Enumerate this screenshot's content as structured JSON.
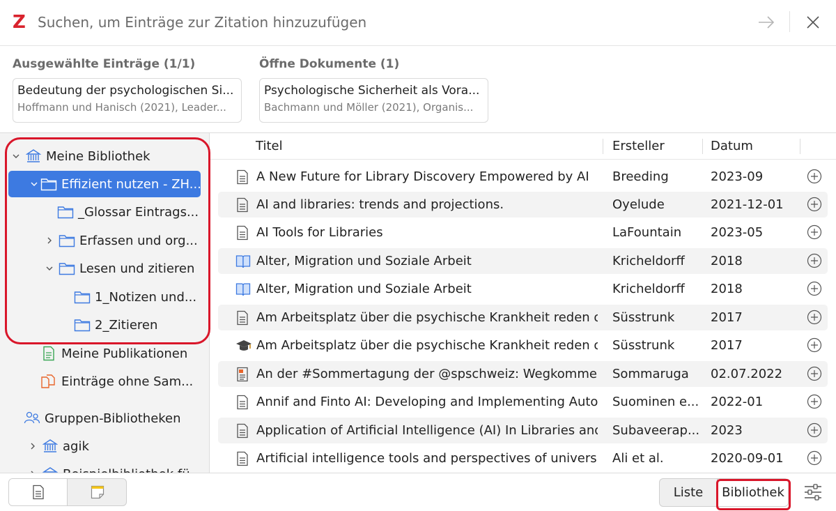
{
  "search": {
    "logo": "Z",
    "placeholder": "Suchen, um Einträge zur Zitation hinzuzufügen"
  },
  "bubbles": {
    "selected_title": "Ausgewählte Einträge (1/1)",
    "open_title": "Öffne Dokumente (1)",
    "selected_item": {
      "title": "Bedeutung der psychologischen Si...",
      "subtitle": "Hoffmann und Hanisch (2021), Leader..."
    },
    "open_item": {
      "title": "Psychologische Sicherheit als Vora...",
      "subtitle": "Bachmann und Möller (2021), Organis..."
    }
  },
  "tree": {
    "items": [
      {
        "label": "Meine Bibliothek",
        "icon": "library-icon",
        "twisty": "chevron-down"
      },
      {
        "label": "Effizient nutzen - ZH...",
        "icon": "folder-icon",
        "twisty": "chevron-down",
        "selected": true
      },
      {
        "label": "_Glossar Eintrags...",
        "icon": "folder-icon",
        "twisty": ""
      },
      {
        "label": "Erfassen und org...",
        "icon": "folder-icon",
        "twisty": "chevron-right"
      },
      {
        "label": "Lesen und zitieren",
        "icon": "folder-icon",
        "twisty": "chevron-down"
      },
      {
        "label": "1_Notizen und...",
        "icon": "folder-icon",
        "twisty": ""
      },
      {
        "label": "2_Zitieren",
        "icon": "folder-icon",
        "twisty": ""
      },
      {
        "label": "Meine Publikationen",
        "icon": "publications-icon",
        "twisty": ""
      },
      {
        "label": "Einträge ohne Sam...",
        "icon": "unfiled-icon",
        "twisty": ""
      },
      {
        "label": "Gruppen-Bibliotheken",
        "icon": "groups-icon",
        "twisty": ""
      },
      {
        "label": "agik",
        "icon": "library-icon",
        "twisty": "chevron-right"
      },
      {
        "label": "Beispielbibliothek fü...",
        "icon": "library-icon",
        "twisty": "chevron-right"
      }
    ]
  },
  "table": {
    "columns": [
      "Titel",
      "Ersteller",
      "Datum"
    ],
    "rows": [
      {
        "type": "document",
        "title": "A New Future for Library Discovery Empowered by AI",
        "creator": "Breeding",
        "date": "2023-09"
      },
      {
        "type": "document",
        "title": "AI and libraries: trends and projections.",
        "creator": "Oyelude",
        "date": "2021-12-01"
      },
      {
        "type": "document",
        "title": "AI Tools for Libraries",
        "creator": "LaFountain",
        "date": "2023-05"
      },
      {
        "type": "book",
        "title": "Alter, Migration und Soziale Arbeit",
        "creator": "Kricheldorff",
        "date": "2018"
      },
      {
        "type": "book",
        "title": "Alter, Migration und Soziale Arbeit",
        "creator": "Kricheldorff",
        "date": "2018"
      },
      {
        "type": "document",
        "title": "Am Arbeitsplatz über die psychische Krankheit reden o...",
        "creator": "Süsstrunk",
        "date": "2017"
      },
      {
        "type": "thesis",
        "title": "Am Arbeitsplatz über die psychische Krankheit reden o...",
        "creator": "Süsstrunk",
        "date": "2017"
      },
      {
        "type": "post",
        "title": "An der #Sommertagung der @spschweiz: Wegkomme...",
        "creator": "Sommaruga",
        "date": "02.07.2022"
      },
      {
        "type": "document",
        "title": "Annif and Finto AI: Developing and Implementing Auto...",
        "creator": "Suominen e...",
        "date": "2022-01"
      },
      {
        "type": "document",
        "title": "Application of Artificial Intelligence (AI) In Libraries and...",
        "creator": "Subaveerap...",
        "date": "2023"
      },
      {
        "type": "document",
        "title": "Artificial intelligence tools and perspectives of universit...",
        "creator": "Ali et al.",
        "date": "2020-09-01"
      }
    ]
  },
  "bottom": {
    "mode_liste": "Liste",
    "mode_bibliothek": "Bibliothek"
  },
  "colors": {
    "accent": "#3d7ae1",
    "highlight": "#d9162a",
    "logo": "#d9232d"
  }
}
